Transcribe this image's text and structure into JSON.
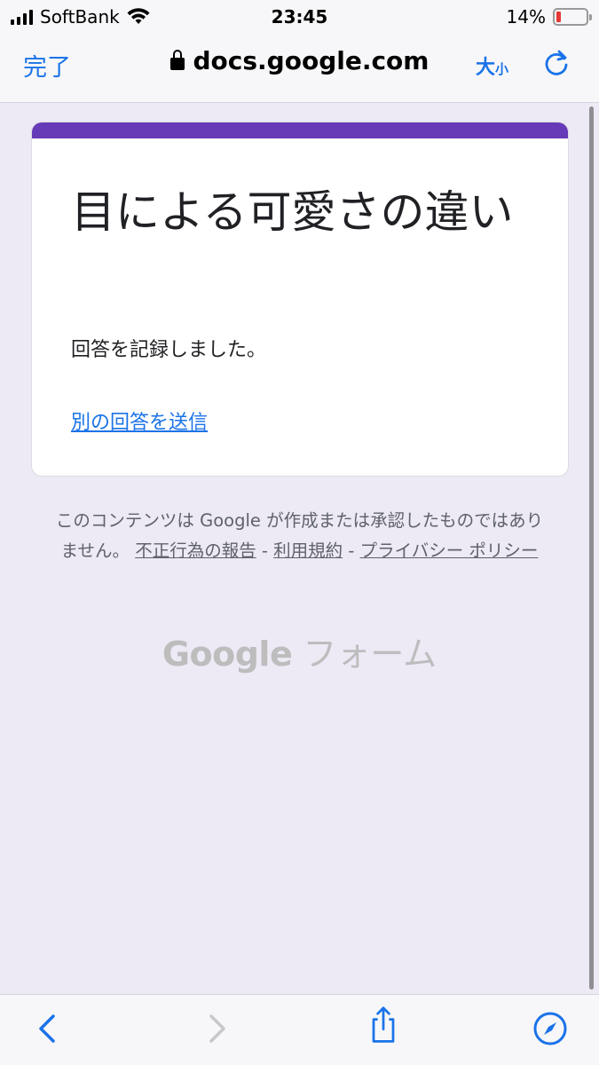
{
  "status_bar": {
    "carrier": "SoftBank",
    "time": "23:45",
    "battery_percent": "14%",
    "battery_level": 0.14
  },
  "browser": {
    "done_label": "完了",
    "url": "docs.google.com",
    "text_size_big": "大",
    "text_size_small": "小"
  },
  "form": {
    "title": "目による可愛さの違い",
    "confirmation": "回答を記録しました。",
    "another_response_link": "別の回答を送信"
  },
  "footer": {
    "disclaimer_part1": "このコンテンツは Google が作成または承認したものではありません。",
    "report_link": "不正行為の報告",
    "sep1": " - ",
    "terms_link": "利用規約",
    "sep2": " - ",
    "privacy_link": "プライバシー ポリシー",
    "logo_google": "Google",
    "logo_forms": "フォーム"
  },
  "colors": {
    "accent": "#673ab7",
    "link": "#1a73e8",
    "background": "#ede9f5"
  },
  "icons": [
    "signal-icon",
    "wifi-icon",
    "battery-icon",
    "lock-icon",
    "reload-icon",
    "back-icon",
    "forward-icon",
    "share-icon",
    "compass-icon"
  ]
}
